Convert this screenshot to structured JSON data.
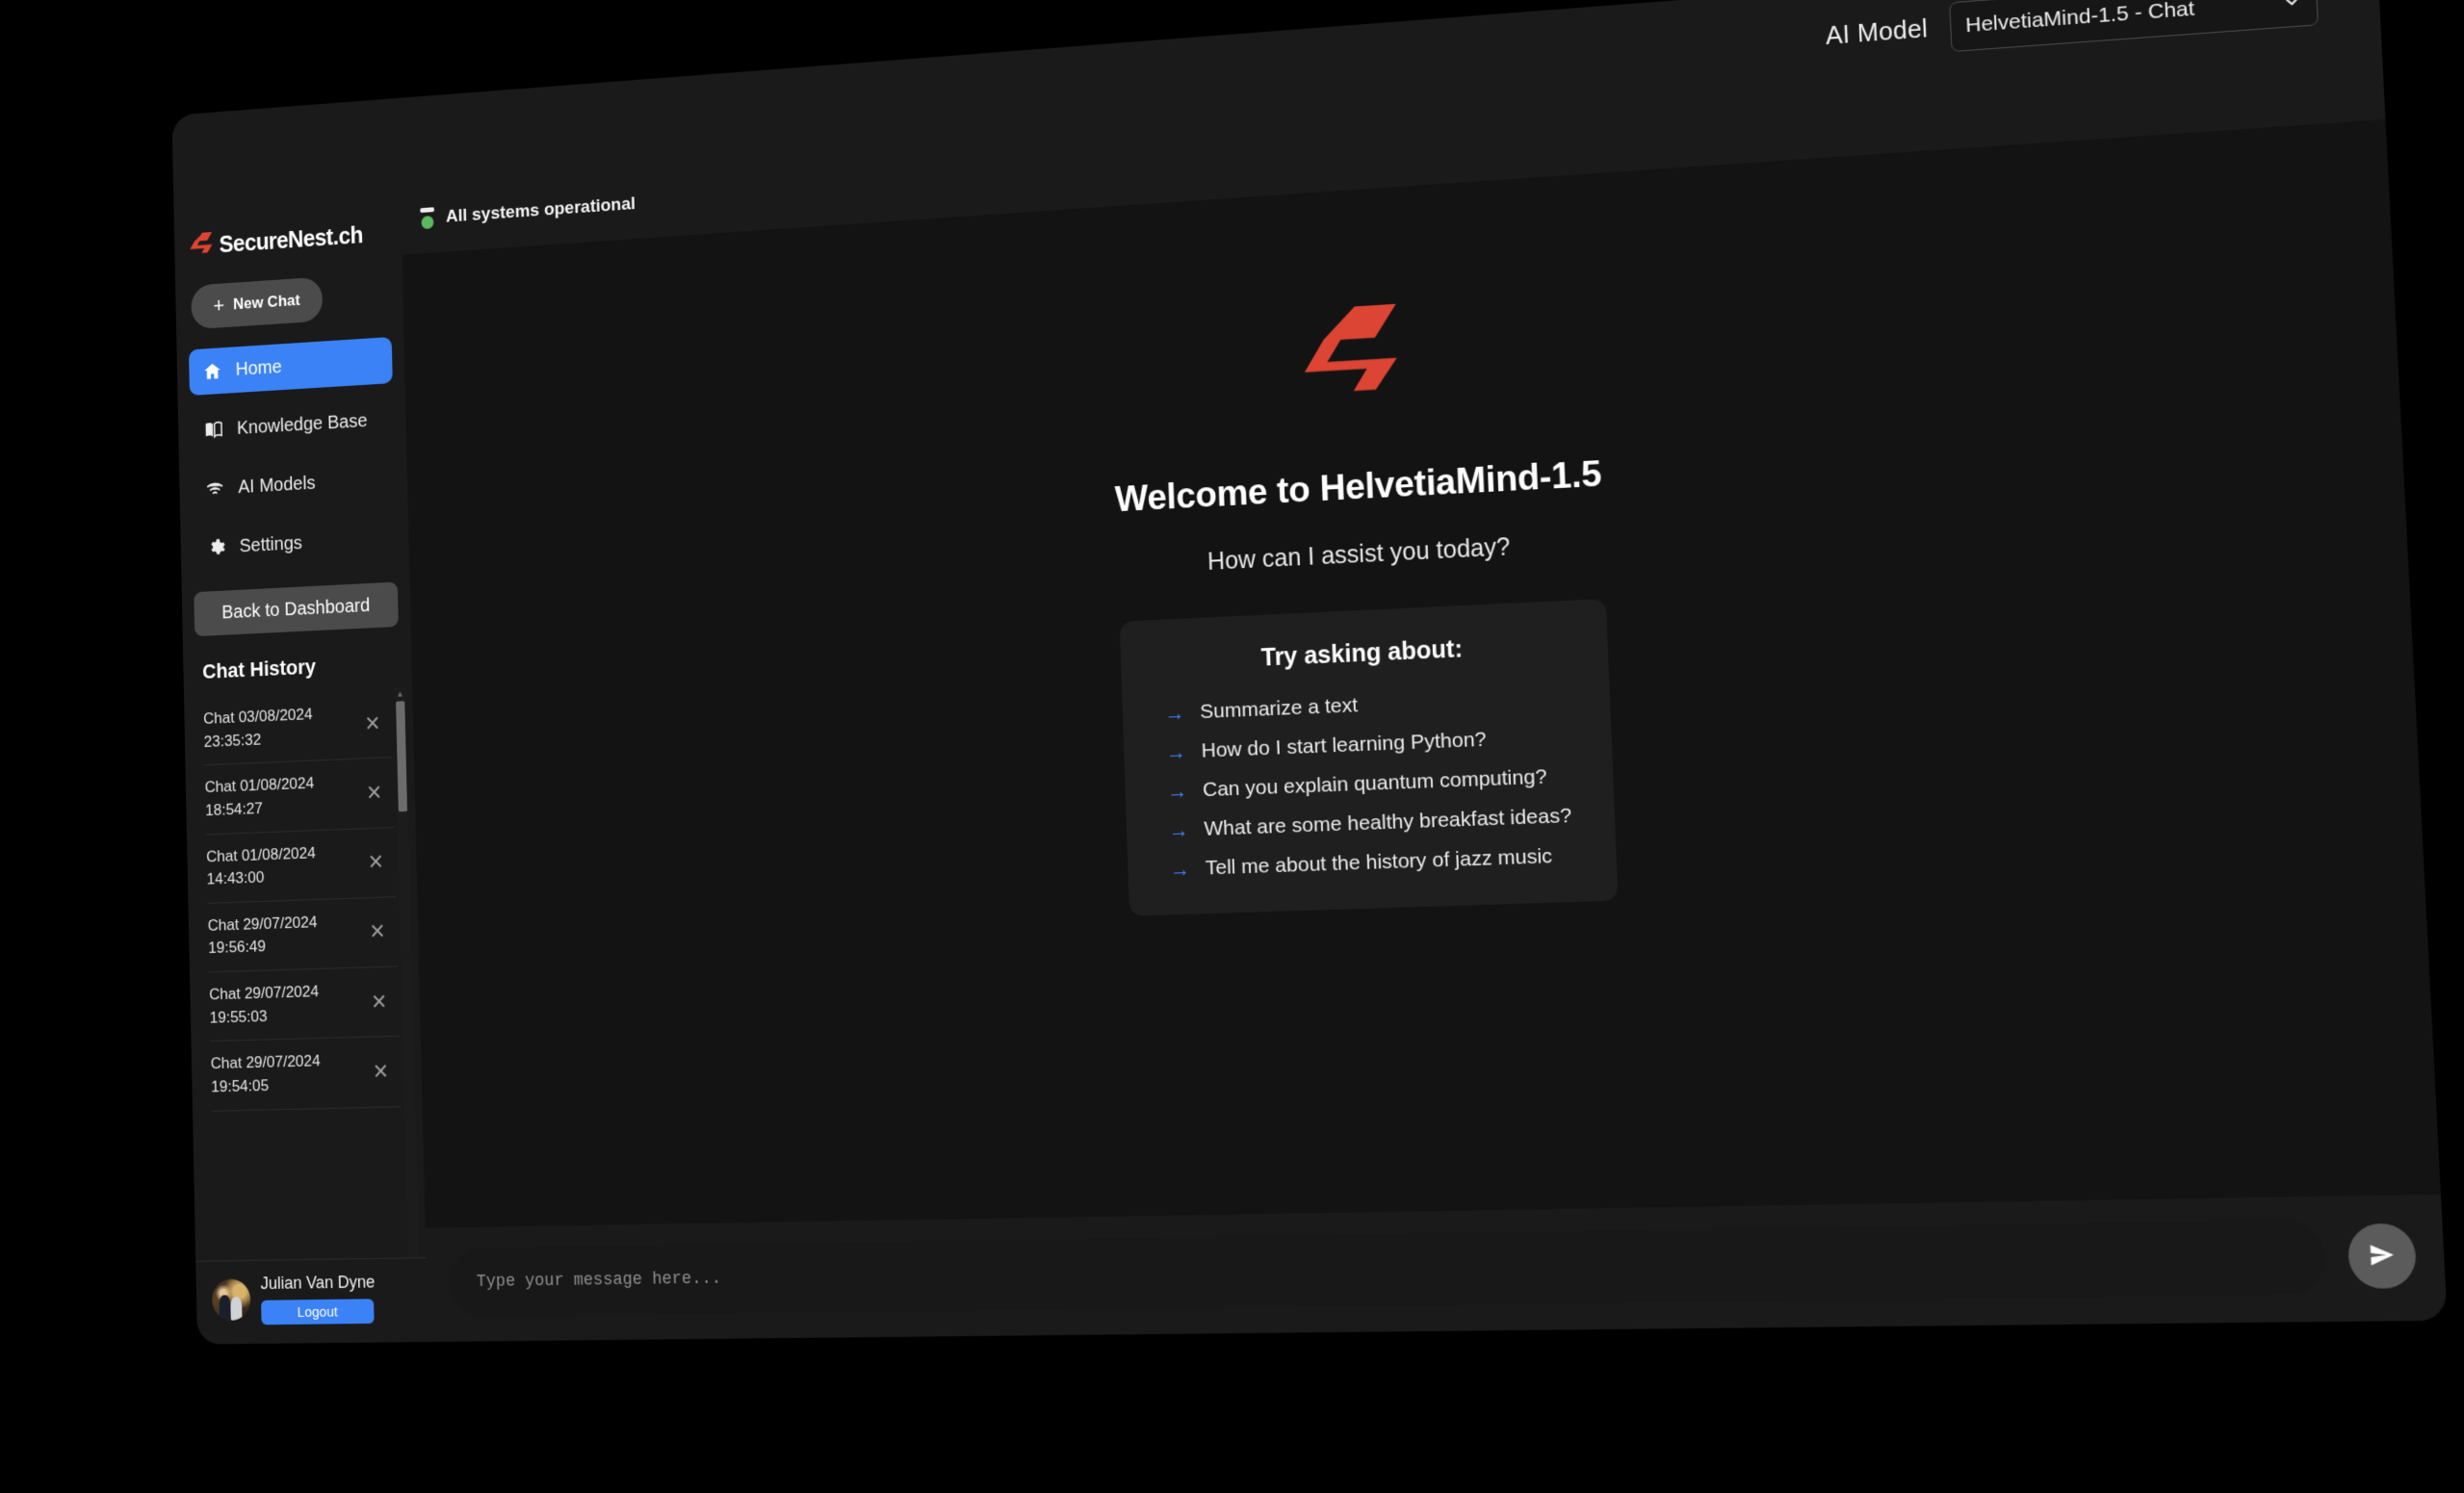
{
  "topbar": {
    "model_label": "AI Model",
    "selected_model": "HelvetiaMind-1.5 - Chat",
    "chevron_icon": "chevron-down-icon"
  },
  "sidebar": {
    "brand": {
      "name": "SecureNest.ch",
      "logo_icon": "securenest-s-logo"
    },
    "new_chat": {
      "label": "New Chat",
      "icon": "plus-icon"
    },
    "nav_items": [
      {
        "label": "Home",
        "icon": "home-icon",
        "active": true
      },
      {
        "label": "Knowledge Base",
        "icon": "book-icon",
        "active": false
      },
      {
        "label": "AI Models",
        "icon": "signal-icon",
        "active": false
      },
      {
        "label": "Settings",
        "icon": "gear-icon",
        "active": false
      }
    ],
    "back_to_dashboard": "Back to Dashboard",
    "chat_history": {
      "title": "Chat History",
      "items": [
        {
          "label": "Chat 03/08/2024 23:35:32",
          "close_icon": "close-icon"
        },
        {
          "label": "Chat 01/08/2024 18:54:27",
          "close_icon": "close-icon"
        },
        {
          "label": "Chat 01/08/2024 14:43:00",
          "close_icon": "close-icon"
        },
        {
          "label": "Chat 29/07/2024 19:56:49",
          "close_icon": "close-icon"
        },
        {
          "label": "Chat 29/07/2024 19:55:03",
          "close_icon": "close-icon"
        },
        {
          "label": "Chat 29/07/2024 19:54:05",
          "close_icon": "close-icon"
        }
      ]
    },
    "user": {
      "name": "Julian Van Dyne",
      "logout_label": "Logout",
      "avatar_icon": "user-avatar"
    }
  },
  "main": {
    "status": {
      "text": "All systems operational",
      "icon": "server-status-icon",
      "color": "#5cb860"
    },
    "hero": {
      "logo_icon": "securenest-s-logo",
      "welcome_title": "Welcome to HelvetiaMind-1.5",
      "subtitle": "How can I assist you today?"
    },
    "suggestions": {
      "title": "Try asking about:",
      "arrow_icon": "arrow-right-icon",
      "items": [
        "Summarize a text",
        "How do I start learning Python?",
        "Can you explain quantum computing?",
        "What are some healthy breakfast ideas?",
        "Tell me about the history of jazz music"
      ]
    },
    "input": {
      "placeholder": "Type your message here...",
      "value": "",
      "send_icon": "send-icon"
    }
  },
  "colors": {
    "accent_blue": "#3b82f6",
    "brand_red": "#dc4433",
    "status_green": "#5cb860",
    "page_bg": "#131313",
    "panel_bg": "#1a1a1a"
  }
}
